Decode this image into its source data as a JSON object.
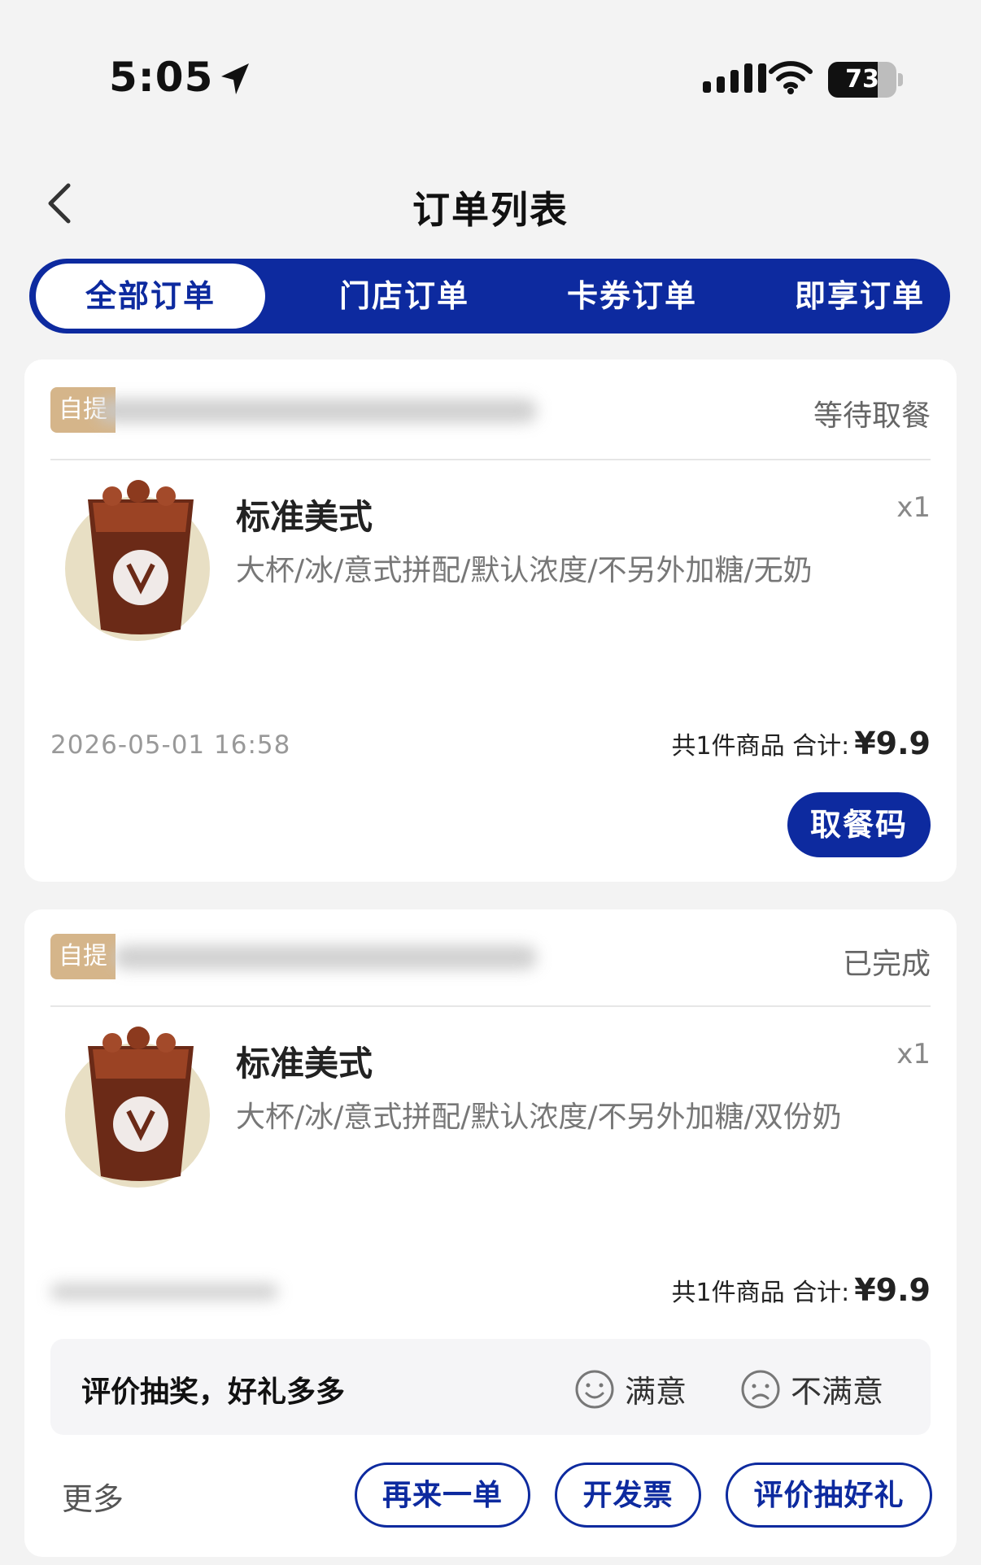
{
  "status_bar": {
    "time": "5:05",
    "battery": "73",
    "battery_level": 0.73
  },
  "header": {
    "title": "订单列表"
  },
  "tabs": [
    {
      "label": "全部订单",
      "active": true
    },
    {
      "label": "门店订单",
      "active": false
    },
    {
      "label": "卡券订单",
      "active": false
    },
    {
      "label": "即享订单",
      "active": false
    }
  ],
  "orders": [
    {
      "badge": "自提",
      "status": "等待取餐",
      "product": {
        "name": "标准美式",
        "qty": "x1",
        "spec": "大杯/冰/意式拼配/默认浓度/不另外加糖/无奶",
        "image_brand": "luckin coffee"
      },
      "time": "2026-05-01 16:58",
      "summary_prefix": "共1件商品 合计:",
      "price": "¥9.9",
      "primary_action": "取餐码"
    },
    {
      "badge": "自提",
      "status": "已完成",
      "product": {
        "name": "标准美式",
        "qty": "x1",
        "spec": "大杯/冰/意式拼配/默认浓度/不另外加糖/双份奶",
        "image_brand": "luckin coffee"
      },
      "summary_prefix": "共1件商品 合计:",
      "price": "¥9.9",
      "review": {
        "label": "评价抽奖，好礼多多",
        "satisfied": "满意",
        "unsatisfied": "不满意"
      },
      "more": "更多",
      "actions": [
        "再来一单",
        "开发票",
        "评价抽好礼"
      ]
    }
  ],
  "colors": {
    "brand": "#0d2a9f",
    "badge": "#d5b58a",
    "background": "#f3f3f3"
  }
}
